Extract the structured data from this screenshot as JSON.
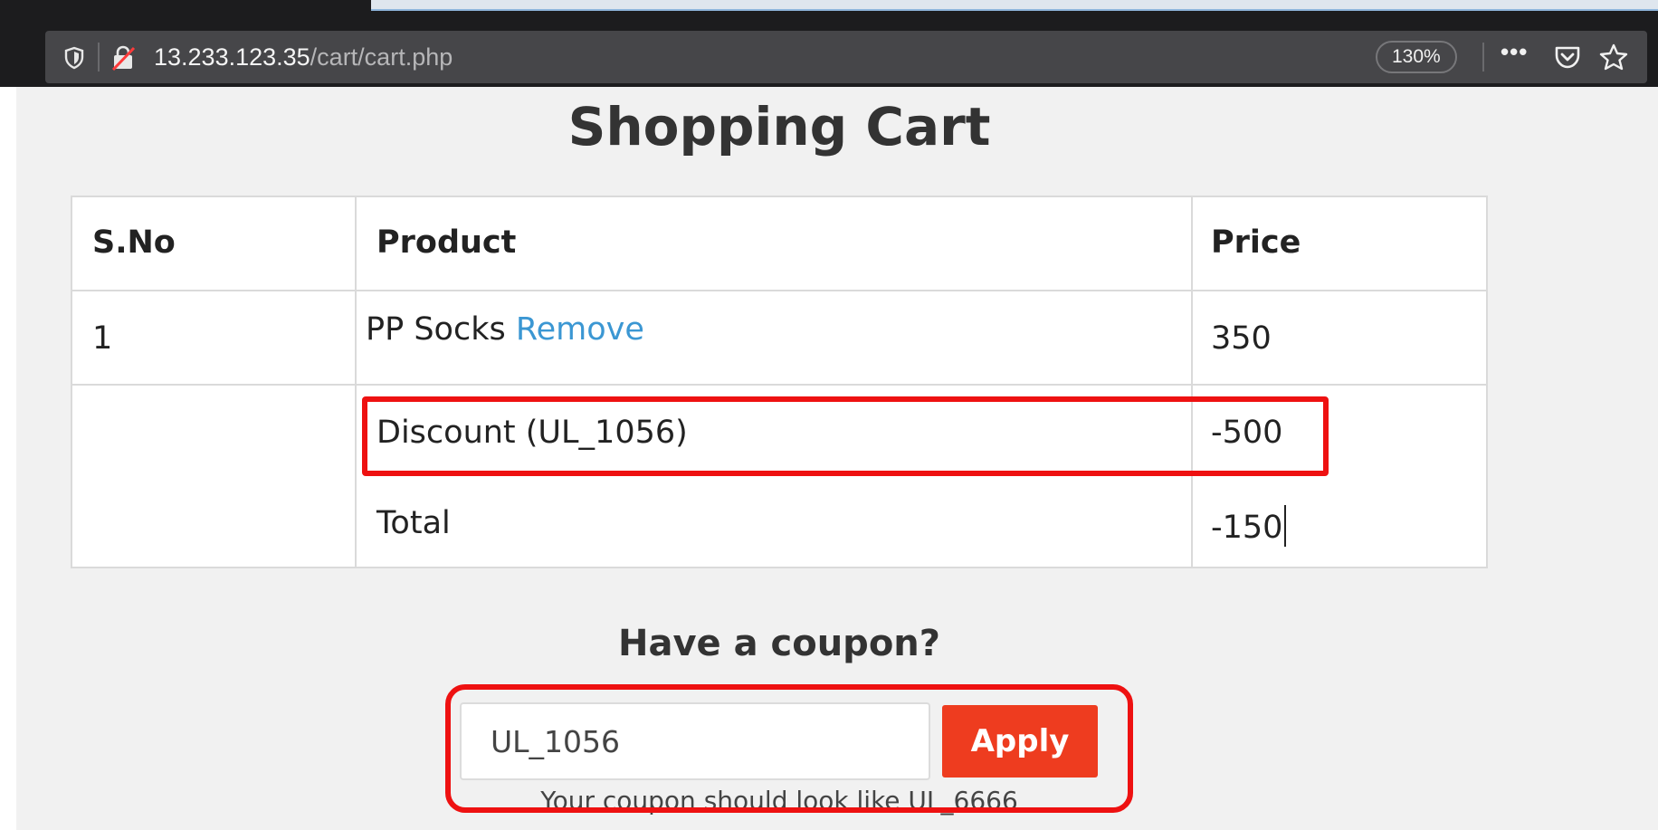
{
  "browser": {
    "url_host": "13.233.123.35",
    "url_path": "/cart/cart.php",
    "zoom": "130%"
  },
  "page": {
    "title": "Shopping Cart"
  },
  "cart": {
    "headers": [
      "S.No",
      "Product",
      "Price"
    ],
    "rows": [
      {
        "sno": "1",
        "product": "PP Socks",
        "action": "Remove",
        "price": "350"
      }
    ],
    "discount": {
      "label": "Discount (UL_1056)",
      "value": "-500"
    },
    "total": {
      "label": "Total",
      "value": "-150"
    }
  },
  "coupon": {
    "title": "Have a coupon?",
    "value": "UL_1056",
    "apply_label": "Apply",
    "hint": "Your coupon should look like UL_6666"
  },
  "colors": {
    "highlight": "#ee1111",
    "apply": "#ee3c1f",
    "link": "#3b97d3"
  }
}
